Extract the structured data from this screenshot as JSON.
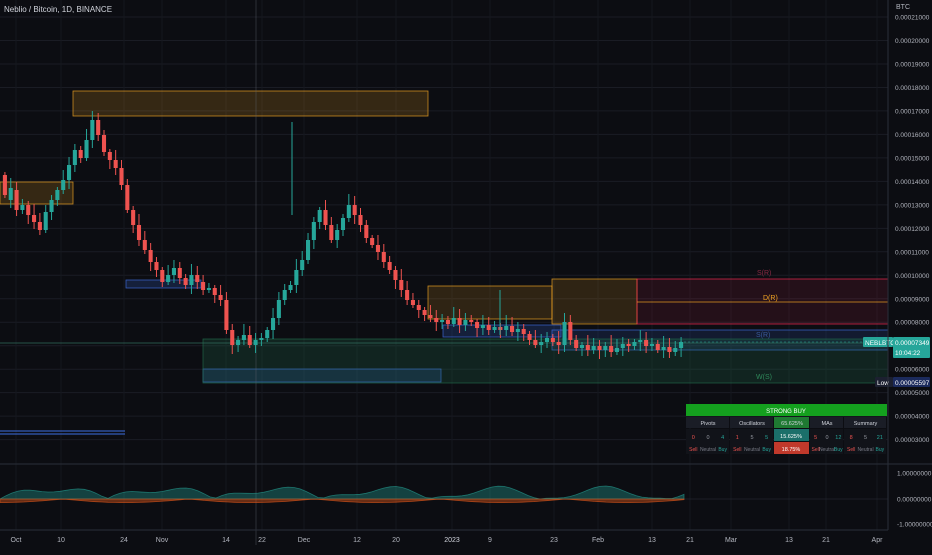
{
  "header": {
    "title": "Neblio / Bitcoin, 1D, BINANCE",
    "unit": "BTC"
  },
  "colors": {
    "background": "#0c0d12",
    "up": "#26a69a",
    "down": "#ef5350",
    "orange": "#f5a623",
    "blue": "#3d6ee0",
    "red_zone": "#ff2d55",
    "green_zone": "#1f6b4a",
    "buy": "#26a69a",
    "sell": "#ef5350"
  },
  "chart_data": [
    {
      "type": "candlestick",
      "title": "Neblio / Bitcoin, 1D, BINANCE",
      "ylabel": "BTC",
      "ylim": [
        2.4e-06,
        2.17e-05
      ],
      "y_ticks": [
        "0.00021000",
        "0.00020000",
        "0.00019000",
        "0.00018000",
        "0.00017000",
        "0.00016000",
        "0.00015000",
        "0.00014000",
        "0.00013000",
        "0.00012000",
        "0.00011000",
        "0.00010000",
        "0.00009000",
        "0.00008000",
        "0.00007000",
        "0.00006000",
        "0.00005000",
        "0.00004000",
        "0.00003000"
      ],
      "x_ticks": [
        "Oct",
        "10",
        "24",
        "Nov",
        "14",
        "22",
        "Dec",
        "12",
        "20",
        "2023",
        "9",
        "23",
        "Feb",
        "13",
        "21",
        "Mar",
        "13",
        "21",
        "Apr"
      ],
      "series": [],
      "last_price_label": "NEBLBTC",
      "last_price": "0.00007349",
      "countdown": "10:04:22",
      "low_label": "Low",
      "low_price": "0.00005597",
      "zone_labels": [
        "S(R)",
        "D(R)",
        "S(R)",
        "W(S)"
      ]
    },
    {
      "type": "line",
      "title": "",
      "ylim": [
        -1,
        1
      ],
      "y_ticks": [
        "1.00000000",
        "0.00000000",
        "-1.00000000"
      ]
    }
  ],
  "ta_table": {
    "summary_label": "STRONG BUY",
    "headers": [
      "Pivots",
      "Oscillators",
      "65.625%",
      "MAs",
      "Summary"
    ],
    "counts": {
      "pivots": [
        "0",
        "0",
        "4"
      ],
      "oscillators": [
        "1",
        "5",
        "5"
      ],
      "osc_pct": "15.625%",
      "mas": [
        "5",
        "0",
        "12"
      ],
      "summary": [
        "8",
        "5",
        "21"
      ]
    },
    "labels": {
      "pivots": [
        "Sell",
        "Neutral",
        "Buy"
      ],
      "oscillators": [
        "Sell",
        "Neutral",
        "Buy"
      ],
      "osc_pct": "18.75%",
      "mas": [
        "Sell",
        "Neutral",
        "Buy"
      ],
      "summary": [
        "Sell",
        "Neutral",
        "Buy"
      ]
    }
  }
}
